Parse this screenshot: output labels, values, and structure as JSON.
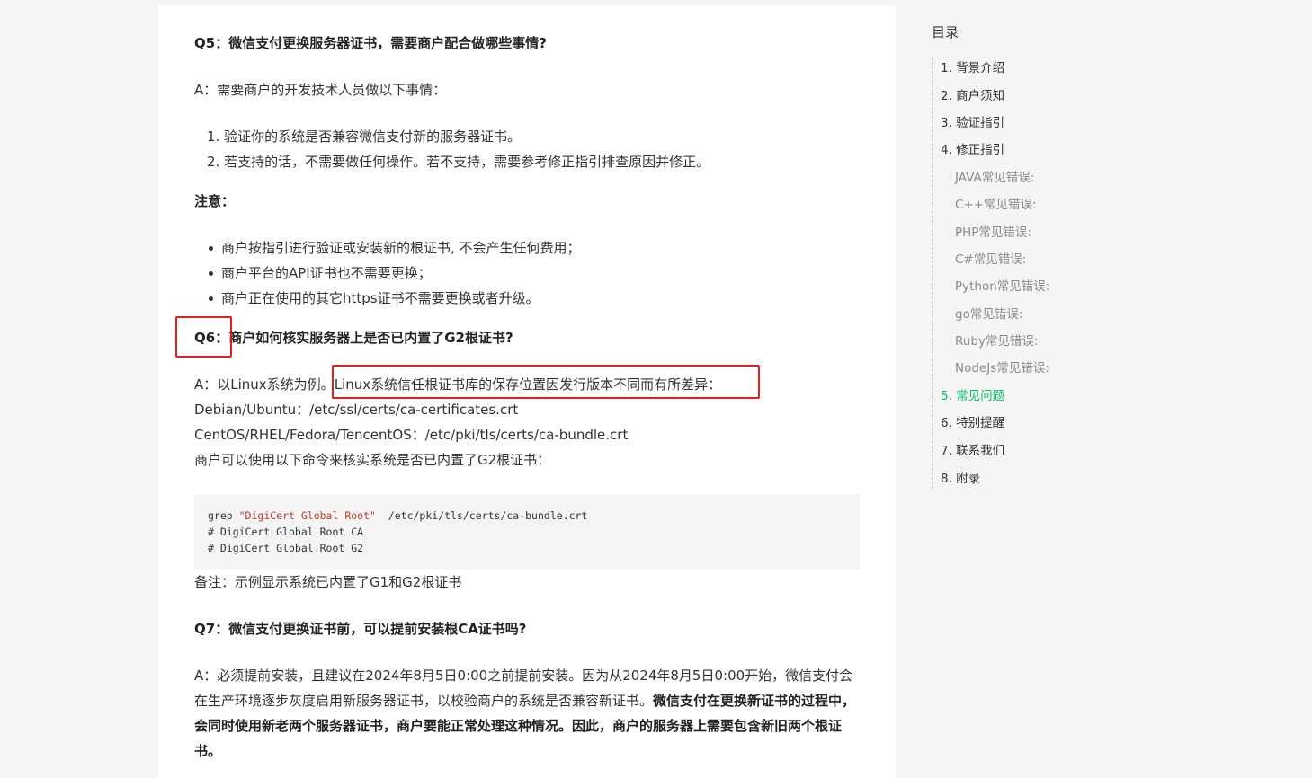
{
  "article": {
    "q5": {
      "title": "Q5：微信支付更换服务器证书，需要商户配合做哪些事情?",
      "answer_intro": "A：需要商户的开发技术人员做以下事情：",
      "steps": [
        "1. 验证你的系统是否兼容微信支付新的服务器证书。",
        "2. 若支持的话，不需要做任何操作。若不支持，需要参考修正指引排查原因并修正。"
      ],
      "note_label": "注意：",
      "notes": [
        "商户按指引进行验证或安装新的根证书, 不会产生任何费用；",
        "商户平台的API证书也不需要更换；",
        "商户正在使用的其它https证书不需要更换或者升级。"
      ]
    },
    "q6": {
      "prefix": "Q6：",
      "title_rest": "商户如何核实服务器上是否已内置了G2根证书?",
      "answer_lead": "A：以Linux系统为例。",
      "answer_highlight": "Linux系统信任根证书库的保存位置因发行版本不同而有所差异：",
      "path_debian": "Debian/Ubuntu：/etc/ssl/certs/ca-certificates.crt",
      "path_centos": "CentOS/RHEL/Fedora/TencentOS：/etc/pki/tls/certs/ca-bundle.crt",
      "command_intro": "商户可以使用以下命令来核实系统是否已内置了G2根证书：",
      "code": {
        "cmd": "grep ",
        "str": "\"DigiCert Global Root\"",
        "path": "  /etc/pki/tls/certs/ca-bundle.crt",
        "out1": "# DigiCert Global Root CA",
        "out2": "# DigiCert Global Root G2"
      },
      "remark": "备注：示例显示系统已内置了G1和G2根证书"
    },
    "q7": {
      "title": "Q7：微信支付更换证书前，可以提前安装根CA证书吗?",
      "answer_normal": "A：必须提前安装，且建议在2024年8月5日0:00之前提前安装。因为从2024年8月5日0:00开始，微信支付会在生产环境逐步灰度启用新服务器证书，以校验商户的系统是否兼容新证书。",
      "answer_bold": "微信支付在更换新证书的过程中，会同时使用新老两个服务器证书，商户要能正常处理这种情况。因此，商户的服务器上需要包含新旧两个根证书。"
    }
  },
  "toc": {
    "title": "目录",
    "items": [
      {
        "label": "1. 背景介绍",
        "level": 1
      },
      {
        "label": "2. 商户须知",
        "level": 1
      },
      {
        "label": "3. 验证指引",
        "level": 1
      },
      {
        "label": "4. 修正指引",
        "level": 1
      },
      {
        "label": "JAVA常见错误:",
        "level": 2
      },
      {
        "label": "C++常见错误:",
        "level": 2
      },
      {
        "label": "PHP常见错误:",
        "level": 2
      },
      {
        "label": "C#常见错误:",
        "level": 2
      },
      {
        "label": "Python常见错误:",
        "level": 2
      },
      {
        "label": "go常见错误:",
        "level": 2
      },
      {
        "label": "Ruby常见错误:",
        "level": 2
      },
      {
        "label": "NodeJs常见错误:",
        "level": 2
      },
      {
        "label": "5. 常见问题",
        "level": 1,
        "active": true
      },
      {
        "label": "6. 特别提醒",
        "level": 1
      },
      {
        "label": "7. 联系我们",
        "level": 1
      },
      {
        "label": "8. 附录",
        "level": 1
      }
    ],
    "active_color": "#07c160"
  },
  "colors": {
    "highlight_box": "#e02020",
    "code_string": "#c0392b"
  }
}
